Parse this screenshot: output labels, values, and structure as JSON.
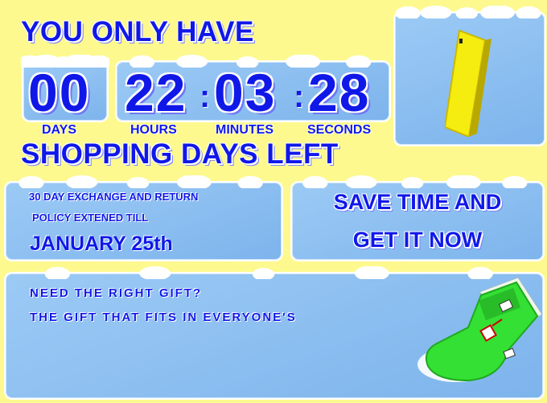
{
  "header": {
    "headline": "YOU ONLY HAVE",
    "subline": "SHOPPING DAYS LEFT"
  },
  "countdown": {
    "days": "00",
    "hours": "22",
    "minutes": "03",
    "seconds": "28",
    "separator": ":",
    "labels": {
      "days": "DAYS",
      "hours": "HOURS",
      "minutes": "MINUTES",
      "seconds": "SECONDS"
    }
  },
  "returns": {
    "line1": "30 DAY EXCHANGE AND RETURN",
    "line2": "POLICY EXTENED TILL",
    "date": "JANUARY 25th"
  },
  "cta": {
    "line1": "SAVE TIME AND",
    "line2": "GET IT NOW"
  },
  "gift": {
    "line1": "NEED THE RIGHT GIFT?",
    "line2": "THE GIFT THAT FITS IN EVERYONE'S"
  },
  "icons": {
    "gift_card": "gift-card-icon",
    "stocking": "stocking-icon"
  },
  "colors": {
    "background": "#fdf98e",
    "panel": "#8fc0f2",
    "text": "#1018e8",
    "card": "#f5ec10",
    "stocking": "#33e033"
  }
}
